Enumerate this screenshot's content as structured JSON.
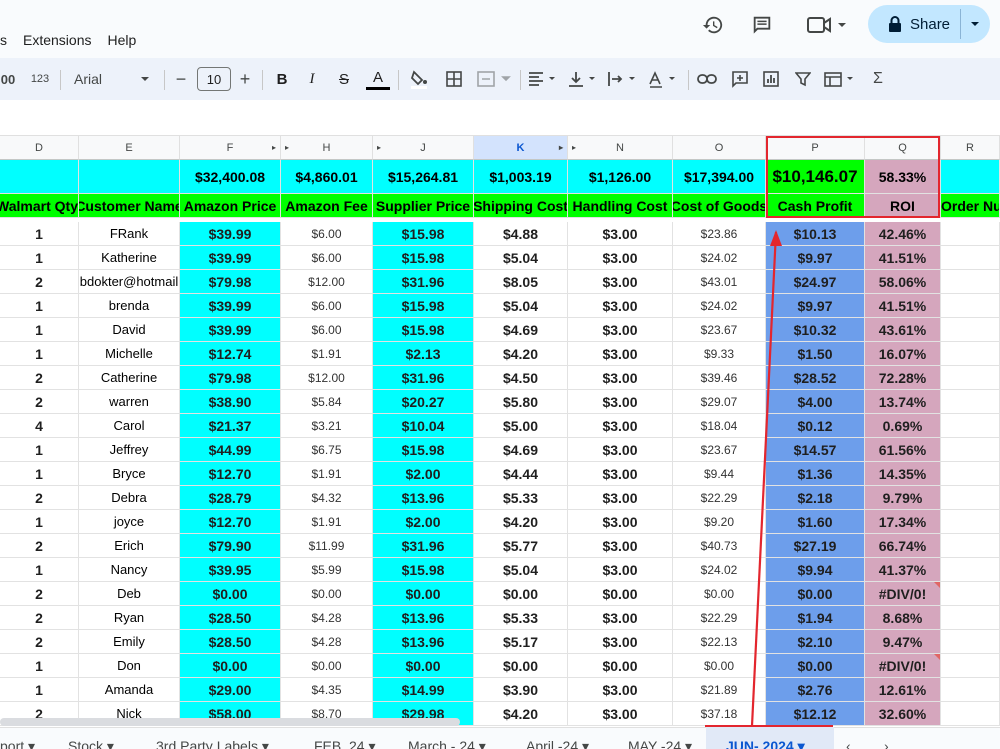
{
  "menu": {
    "items": [
      "s",
      "Extensions",
      "Help"
    ]
  },
  "share": {
    "label": "Share"
  },
  "toolbar": {
    "zoom_fragment": "00",
    "format_123": "123",
    "font": "Arial",
    "font_size": "10"
  },
  "columns": [
    "D",
    "E",
    "F",
    "H",
    "J",
    "K",
    "N",
    "O",
    "P",
    "Q",
    "R"
  ],
  "selected_column": "K",
  "totals": {
    "F": "$32,400.08",
    "H": "$4,860.01",
    "J": "$15,264.81",
    "K": "$1,003.19",
    "N": "$1,126.00",
    "O": "$17,394.00",
    "P": "$10,146.07",
    "Q": "58.33%"
  },
  "headers": {
    "D": "Walmart Qty",
    "E": "Customer Name",
    "F": "Amazon Price",
    "H": "Amazon Fee",
    "J": "Supplier Price",
    "K": "Shipping Cost",
    "N": "Handling Cost",
    "O": "Cost of Goods",
    "P": "Cash Profit",
    "Q": "ROI",
    "R": "Order Number"
  },
  "rows": [
    [
      "1",
      "FRank",
      "$39.99",
      "$6.00",
      "$15.98",
      "$4.88",
      "$3.00",
      "$23.86",
      "$10.13",
      "42.46%"
    ],
    [
      "1",
      "Katherine",
      "$39.99",
      "$6.00",
      "$15.98",
      "$5.04",
      "$3.00",
      "$24.02",
      "$9.97",
      "41.51%"
    ],
    [
      "2",
      "bdokter@hotmail",
      "$79.98",
      "$12.00",
      "$31.96",
      "$8.05",
      "$3.00",
      "$43.01",
      "$24.97",
      "58.06%"
    ],
    [
      "1",
      "brenda",
      "$39.99",
      "$6.00",
      "$15.98",
      "$5.04",
      "$3.00",
      "$24.02",
      "$9.97",
      "41.51%"
    ],
    [
      "1",
      "David",
      "$39.99",
      "$6.00",
      "$15.98",
      "$4.69",
      "$3.00",
      "$23.67",
      "$10.32",
      "43.61%"
    ],
    [
      "1",
      "Michelle",
      "$12.74",
      "$1.91",
      "$2.13",
      "$4.20",
      "$3.00",
      "$9.33",
      "$1.50",
      "16.07%"
    ],
    [
      "2",
      "Catherine",
      "$79.98",
      "$12.00",
      "$31.96",
      "$4.50",
      "$3.00",
      "$39.46",
      "$28.52",
      "72.28%"
    ],
    [
      "2",
      "warren",
      "$38.90",
      "$5.84",
      "$20.27",
      "$5.80",
      "$3.00",
      "$29.07",
      "$4.00",
      "13.74%"
    ],
    [
      "4",
      "Carol",
      "$21.37",
      "$3.21",
      "$10.04",
      "$5.00",
      "$3.00",
      "$18.04",
      "$0.12",
      "0.69%"
    ],
    [
      "1",
      "Jeffrey",
      "$44.99",
      "$6.75",
      "$15.98",
      "$4.69",
      "$3.00",
      "$23.67",
      "$14.57",
      "61.56%"
    ],
    [
      "1",
      "Bryce",
      "$12.70",
      "$1.91",
      "$2.00",
      "$4.44",
      "$3.00",
      "$9.44",
      "$1.36",
      "14.35%"
    ],
    [
      "2",
      "Debra",
      "$28.79",
      "$4.32",
      "$13.96",
      "$5.33",
      "$3.00",
      "$22.29",
      "$2.18",
      "9.79%"
    ],
    [
      "1",
      "joyce",
      "$12.70",
      "$1.91",
      "$2.00",
      "$4.20",
      "$3.00",
      "$9.20",
      "$1.60",
      "17.34%"
    ],
    [
      "2",
      "Erich",
      "$79.90",
      "$11.99",
      "$31.96",
      "$5.77",
      "$3.00",
      "$40.73",
      "$27.19",
      "66.74%"
    ],
    [
      "1",
      "Nancy",
      "$39.95",
      "$5.99",
      "$15.98",
      "$5.04",
      "$3.00",
      "$24.02",
      "$9.94",
      "41.37%"
    ],
    [
      "2",
      "Deb",
      "$0.00",
      "$0.00",
      "$0.00",
      "$0.00",
      "$0.00",
      "$0.00",
      "$0.00",
      "#DIV/0!"
    ],
    [
      "2",
      "Ryan",
      "$28.50",
      "$4.28",
      "$13.96",
      "$5.33",
      "$3.00",
      "$22.29",
      "$1.94",
      "8.68%"
    ],
    [
      "2",
      "Emily",
      "$28.50",
      "$4.28",
      "$13.96",
      "$5.17",
      "$3.00",
      "$22.13",
      "$2.10",
      "9.47%"
    ],
    [
      "1",
      "Don",
      "$0.00",
      "$0.00",
      "$0.00",
      "$0.00",
      "$0.00",
      "$0.00",
      "$0.00",
      "#DIV/0!"
    ],
    [
      "1",
      "Amanda",
      "$29.00",
      "$4.35",
      "$14.99",
      "$3.90",
      "$3.00",
      "$21.89",
      "$2.76",
      "12.61%"
    ],
    [
      "2",
      "Nick",
      "$58.00",
      "$8.70",
      "$29.98",
      "$4.20",
      "$3.00",
      "$37.18",
      "$12.12",
      "32.60%"
    ]
  ],
  "sheet_tabs": [
    "port",
    "Stock",
    "3rd Party Labels",
    "FEB. 24",
    "March - 24",
    "April -24",
    "MAY -24",
    "JUN- 2024"
  ],
  "active_tab": "JUN- 2024"
}
